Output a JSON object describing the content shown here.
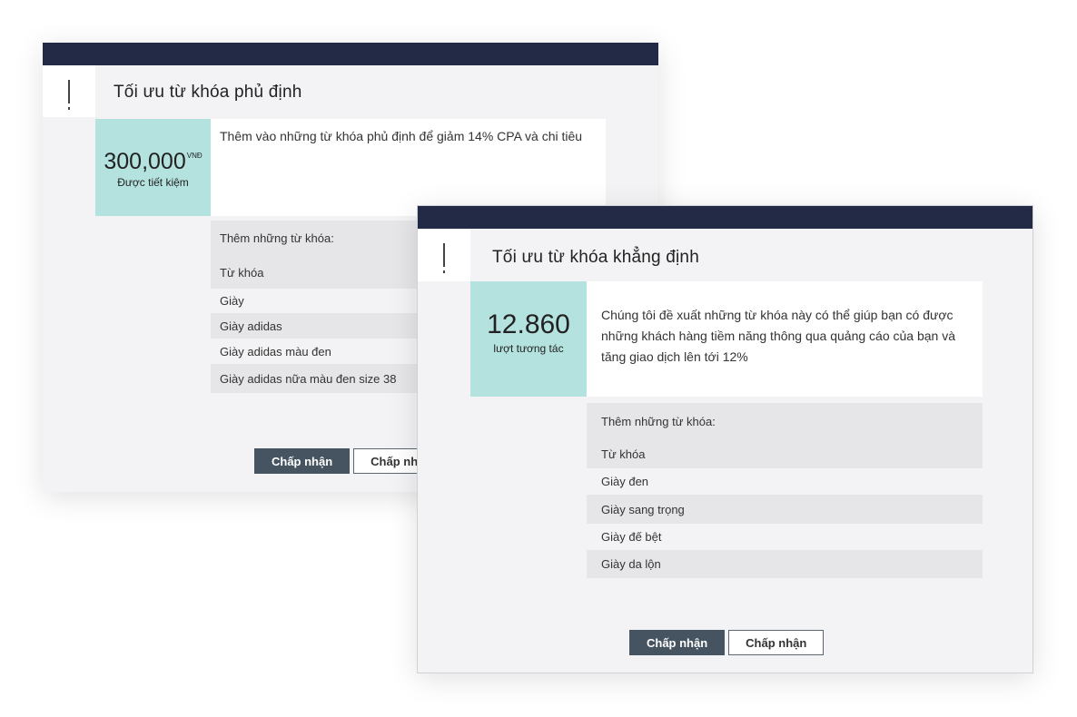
{
  "cards": [
    {
      "title": "Tối ưu từ khóa phủ định",
      "metric": {
        "value": "300,000",
        "unit": "VNĐ",
        "caption": "Được tiết kiệm"
      },
      "description": "Thêm vào những từ khóa phủ định để giảm 14% CPA và chi tiêu",
      "keywords_header": "Thêm những từ khóa:",
      "keywords_column": "Từ khóa",
      "keywords": [
        "Giày",
        "Giày adidas",
        "Giày adidas màu đen",
        "Giày adidas nữa màu đen size 38"
      ],
      "buttons": {
        "accept": "Chấp nhận",
        "second": "Chấp nhận"
      }
    },
    {
      "title": "Tối ưu từ khóa khẳng định",
      "metric": {
        "value": "12.860",
        "caption": "lượt tương tác"
      },
      "description": "Chúng tôi đề xuất những từ khóa này có thể giúp bạn có được những khách hàng tiềm năng thông qua quảng cáo của bạn và tăng giao dịch lên tới 12%",
      "keywords_header": "Thêm những từ khóa:",
      "keywords_column": "Từ khóa",
      "keywords": [
        "Giày đen",
        "Giày sang trọng",
        "Giày đế bệt",
        "Giày da lộn"
      ],
      "buttons": {
        "accept": "Chấp nhận",
        "second": "Chấp nhận"
      }
    }
  ],
  "colors": {
    "topbar": "#222a45",
    "metric_bg": "#b4e2df",
    "primary_button": "#465462",
    "row_gray": "#e6e6e8"
  },
  "icons": [
    "alert-exclamation-icon"
  ]
}
